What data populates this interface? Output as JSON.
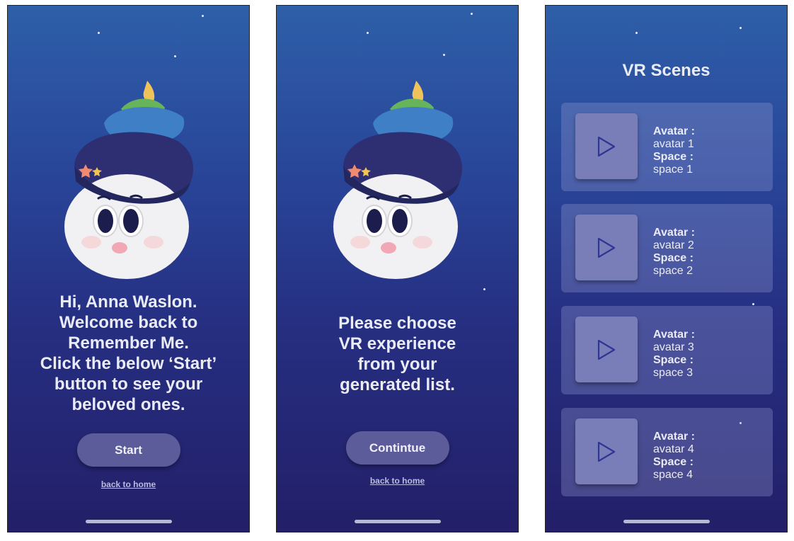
{
  "screen1": {
    "message": "Hi, Anna Waslon.\nWelcome back to\nRemember Me.\nClick the below ‘Start’\nbutton to see your\nbeloved ones.",
    "button_label": "Start",
    "link_label": "back to home"
  },
  "screen2": {
    "message": "Please choose\nVR experience\nfrom your\ngenerated list.",
    "button_label": "Contintue",
    "link_label": "back to home"
  },
  "screen3": {
    "title": "VR Scenes",
    "scenes": [
      {
        "avatar_label": "Avatar :",
        "avatar": "avatar 1",
        "space_label": "Space :",
        "space": "space 1"
      },
      {
        "avatar_label": "Avatar :",
        "avatar": "avatar 2",
        "space_label": "Space :",
        "space": "space 2"
      },
      {
        "avatar_label": "Avatar :",
        "avatar": "avatar 3",
        "space_label": "Space :",
        "space": "space 3"
      },
      {
        "avatar_label": "Avatar :",
        "avatar": "avatar 4",
        "space_label": "Space :",
        "space": "space 4"
      }
    ]
  },
  "icons": {
    "mascot": "mascot-character-icon",
    "play": "play-icon"
  },
  "colors": {
    "background_top": "#2e5fa8",
    "background_bottom": "#231f68",
    "button": "#5d5c9a",
    "text": "#e9ebf6"
  }
}
